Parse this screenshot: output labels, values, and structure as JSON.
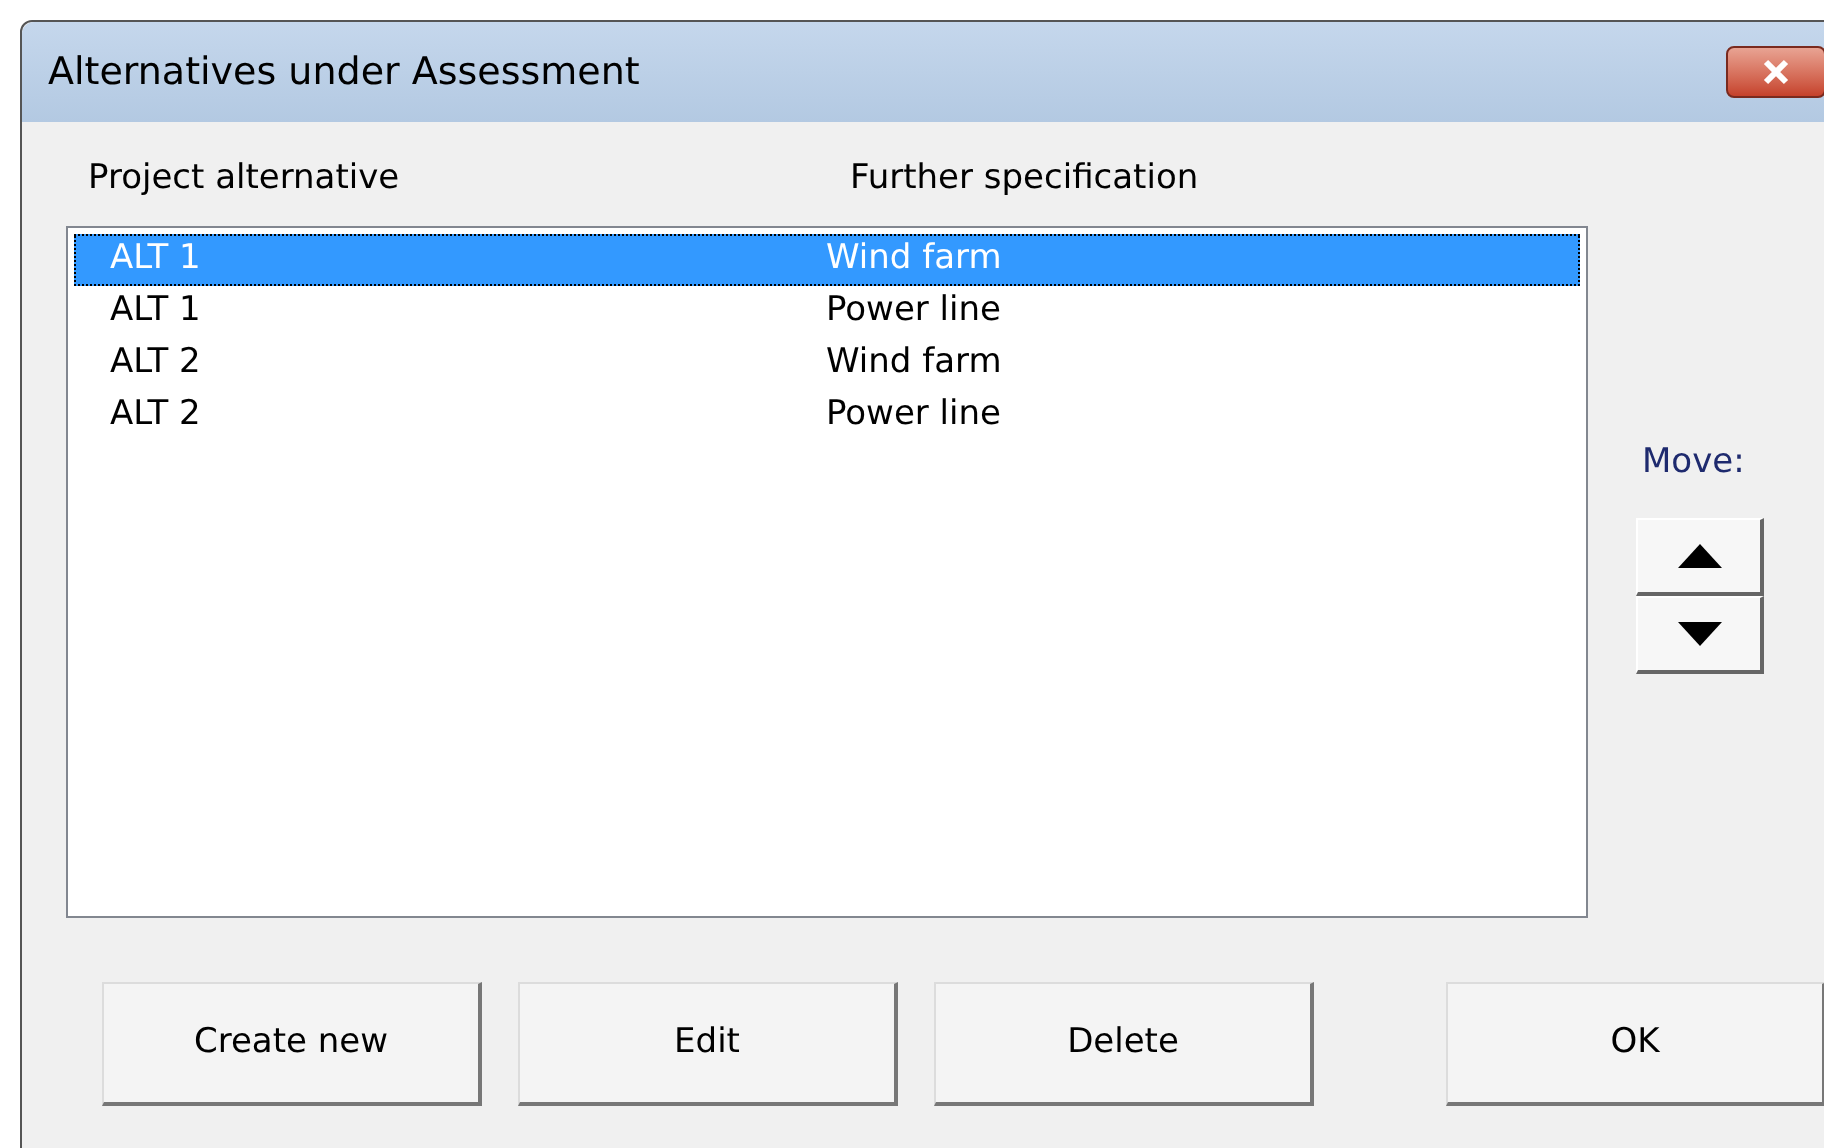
{
  "window": {
    "title": "Alternatives under Assessment"
  },
  "columns": [
    "Project alternative",
    "Further specification"
  ],
  "rows": [
    {
      "alternative": "ALT 1",
      "specification": "Wind farm",
      "selected": true
    },
    {
      "alternative": "ALT 1",
      "specification": "Power line",
      "selected": false
    },
    {
      "alternative": "ALT 2",
      "specification": "Wind farm",
      "selected": false
    },
    {
      "alternative": "ALT 2",
      "specification": "Power line",
      "selected": false
    }
  ],
  "move_label": "Move:",
  "buttons": [
    "Create new",
    "Edit",
    "Delete",
    "OK"
  ]
}
